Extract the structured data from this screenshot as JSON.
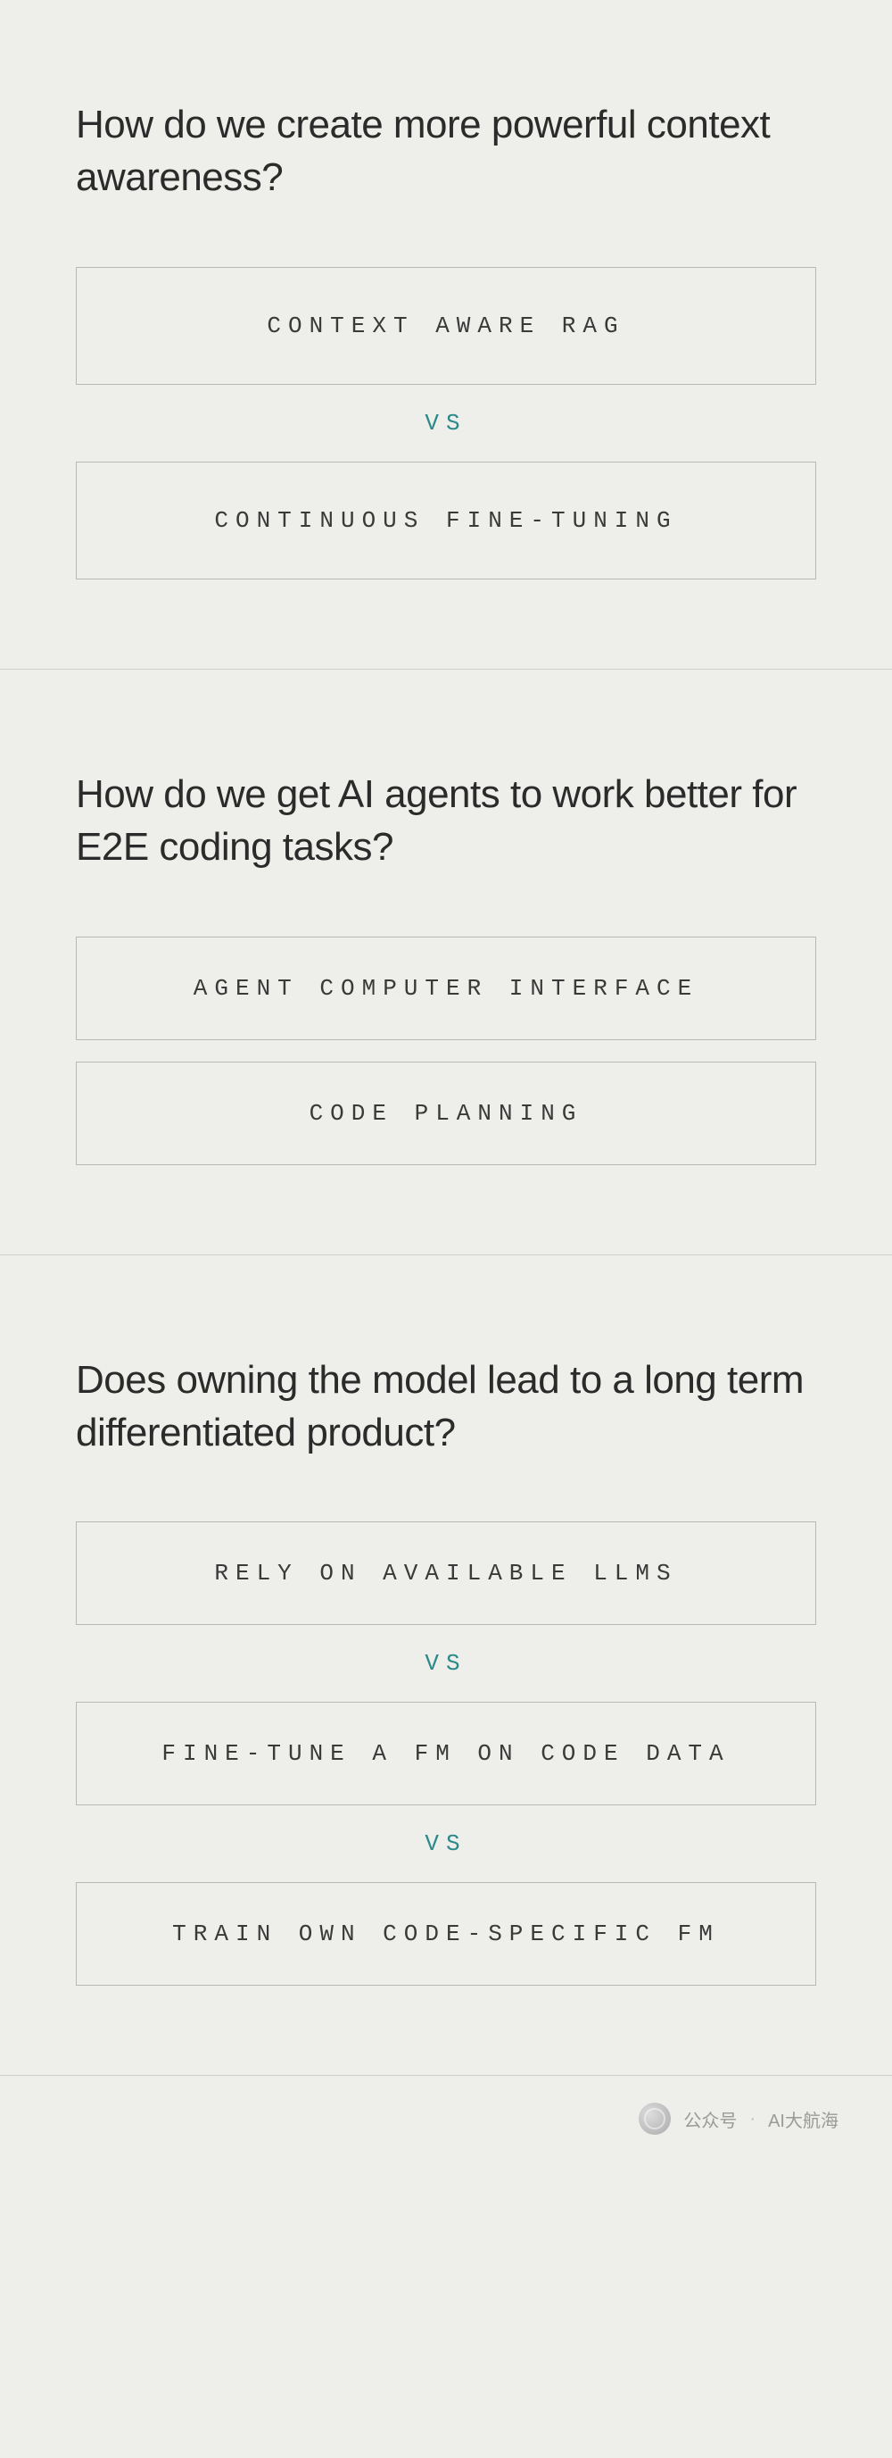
{
  "sections": [
    {
      "question": "How do we create more powerful context awareness?",
      "items": [
        {
          "type": "box",
          "label": "CONTEXT AWARE RAG"
        },
        {
          "type": "vs",
          "label": "VS"
        },
        {
          "type": "box",
          "label": "CONTINUOUS FINE-TUNING"
        }
      ]
    },
    {
      "question": "How do we get AI agents to work better for E2E coding tasks?",
      "items": [
        {
          "type": "box",
          "label": "AGENT COMPUTER INTERFACE"
        },
        {
          "type": "gap",
          "label": ""
        },
        {
          "type": "box",
          "label": "CODE PLANNING"
        }
      ]
    },
    {
      "question": "Does owning the model lead to a long term differentiated product?",
      "items": [
        {
          "type": "box",
          "label": "RELY ON AVAILABLE LLMS"
        },
        {
          "type": "vs",
          "label": "VS"
        },
        {
          "type": "box",
          "label": "FINE-TUNE A FM ON CODE DATA"
        },
        {
          "type": "vs",
          "label": "VS"
        },
        {
          "type": "box",
          "label": "TRAIN OWN CODE-SPECIFIC FM"
        }
      ]
    }
  ],
  "footer": {
    "prefix": "公众号",
    "separator": "·",
    "account": "AI大航海"
  }
}
